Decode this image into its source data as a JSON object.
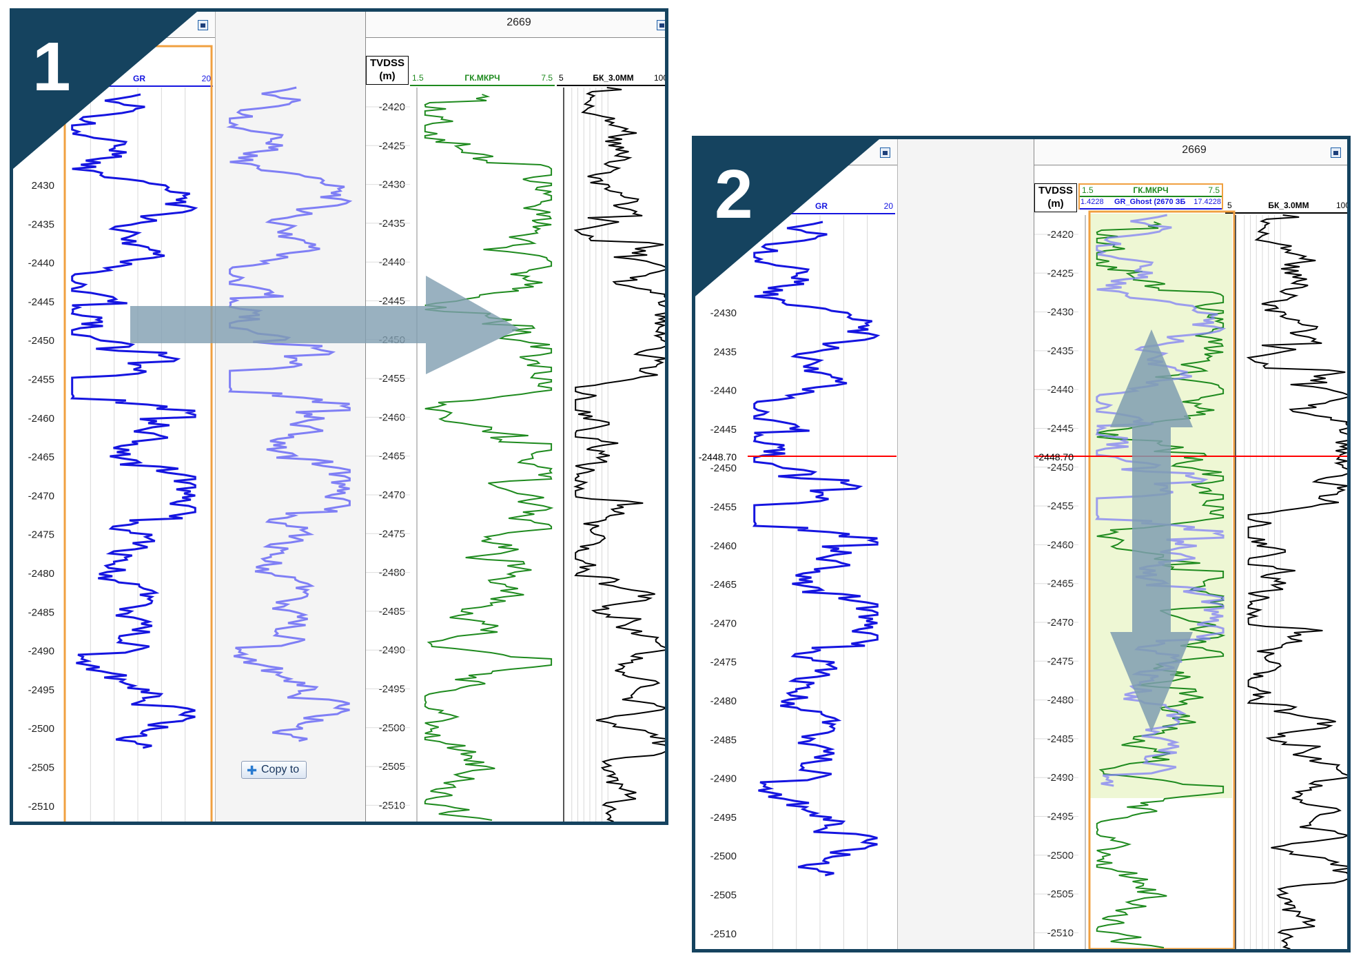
{
  "colors": {
    "frame": "#15435f",
    "gr_blue": "#1515e0",
    "ghost_blue": "#7f7ff5",
    "gk_green": "#1e8a1e",
    "bk_black": "#000000",
    "orange": "#f0a040",
    "marker_red": "#ff0000",
    "overlay": "#eef7d4",
    "arrow": "#7f9eb0"
  },
  "icons": {
    "lock": "lock-icon",
    "arrow_right": "arrow-right-icon",
    "arrow_updown": "arrow-up-down-icon",
    "plus": "plus-icon"
  },
  "panel1": {
    "badge": "1",
    "well_number": "2669",
    "depth_header": "TVDSS\n(m)",
    "depth_ticks": [
      "-2420",
      "-2425",
      "-2430",
      "-2435",
      "-2440",
      "-2445",
      "-2450",
      "-2455",
      "-2460",
      "-2465",
      "-2470",
      "-2475",
      "-2480",
      "-2485",
      "-2490",
      "-2495",
      "-2500",
      "-2505",
      "-2510"
    ],
    "left_ticks": [
      "2430",
      "-2435",
      "-2440",
      "-2445",
      "-2450",
      "-2455",
      "-2460",
      "-2465",
      "-2470",
      "-2475",
      "-2480",
      "-2485",
      "-2490",
      "-2495",
      "-2500",
      "-2505",
      "-2510"
    ],
    "gr": {
      "name": "GR",
      "max": "20"
    },
    "gk": {
      "min": "1.5",
      "name": "ГК.МКРЧ",
      "max": "7.5"
    },
    "bk": {
      "min": "5",
      "name": "БК_3.0ММ",
      "max": "100"
    },
    "copy_button": "Copy to"
  },
  "panel2": {
    "badge": "2",
    "well_number": "2669",
    "depth_header": "TVDSS\n(m)",
    "depth_ticks": [
      "-2420",
      "-2425",
      "-2430",
      "-2435",
      "-2440",
      "-2445",
      "-2450",
      "-2455",
      "-2460",
      "-2465",
      "-2470",
      "-2475",
      "-2480",
      "-2485",
      "-2490",
      "-2495",
      "-2500",
      "-2505",
      "-2510"
    ],
    "left_ticks": [
      "-2430",
      "2435",
      "-2440",
      "-2445",
      "-2450",
      "-2455",
      "-2460",
      "-2465",
      "-2470",
      "-2475",
      "-2480",
      "-2485",
      "-2490",
      "-2495",
      "-2500",
      "-2505",
      "-2510"
    ],
    "marker": "-2448.70",
    "gr": {
      "name": "GR",
      "max": "20"
    },
    "gk": {
      "min": "1.5",
      "name": "ГК.МКРЧ",
      "max": "7.5"
    },
    "ghost": {
      "min": "1.4228",
      "name": "GR_Ghost (2670 ЗБ",
      "max": "17.4228"
    },
    "bk": {
      "min": "5",
      "name": "БК_3.0ММ",
      "max": "100"
    }
  }
}
